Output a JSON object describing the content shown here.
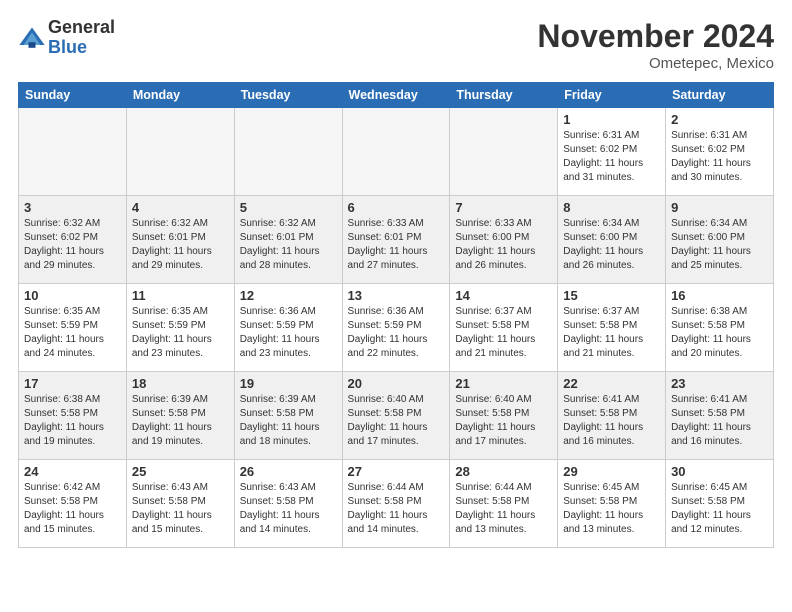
{
  "logo": {
    "general": "General",
    "blue": "Blue"
  },
  "title": "November 2024",
  "location": "Ometepec, Mexico",
  "weekdays": [
    "Sunday",
    "Monday",
    "Tuesday",
    "Wednesday",
    "Thursday",
    "Friday",
    "Saturday"
  ],
  "weeks": [
    [
      {
        "day": "",
        "info": ""
      },
      {
        "day": "",
        "info": ""
      },
      {
        "day": "",
        "info": ""
      },
      {
        "day": "",
        "info": ""
      },
      {
        "day": "",
        "info": ""
      },
      {
        "day": "1",
        "info": "Sunrise: 6:31 AM\nSunset: 6:02 PM\nDaylight: 11 hours\nand 31 minutes."
      },
      {
        "day": "2",
        "info": "Sunrise: 6:31 AM\nSunset: 6:02 PM\nDaylight: 11 hours\nand 30 minutes."
      }
    ],
    [
      {
        "day": "3",
        "info": "Sunrise: 6:32 AM\nSunset: 6:02 PM\nDaylight: 11 hours\nand 29 minutes."
      },
      {
        "day": "4",
        "info": "Sunrise: 6:32 AM\nSunset: 6:01 PM\nDaylight: 11 hours\nand 29 minutes."
      },
      {
        "day": "5",
        "info": "Sunrise: 6:32 AM\nSunset: 6:01 PM\nDaylight: 11 hours\nand 28 minutes."
      },
      {
        "day": "6",
        "info": "Sunrise: 6:33 AM\nSunset: 6:01 PM\nDaylight: 11 hours\nand 27 minutes."
      },
      {
        "day": "7",
        "info": "Sunrise: 6:33 AM\nSunset: 6:00 PM\nDaylight: 11 hours\nand 26 minutes."
      },
      {
        "day": "8",
        "info": "Sunrise: 6:34 AM\nSunset: 6:00 PM\nDaylight: 11 hours\nand 26 minutes."
      },
      {
        "day": "9",
        "info": "Sunrise: 6:34 AM\nSunset: 6:00 PM\nDaylight: 11 hours\nand 25 minutes."
      }
    ],
    [
      {
        "day": "10",
        "info": "Sunrise: 6:35 AM\nSunset: 5:59 PM\nDaylight: 11 hours\nand 24 minutes."
      },
      {
        "day": "11",
        "info": "Sunrise: 6:35 AM\nSunset: 5:59 PM\nDaylight: 11 hours\nand 23 minutes."
      },
      {
        "day": "12",
        "info": "Sunrise: 6:36 AM\nSunset: 5:59 PM\nDaylight: 11 hours\nand 23 minutes."
      },
      {
        "day": "13",
        "info": "Sunrise: 6:36 AM\nSunset: 5:59 PM\nDaylight: 11 hours\nand 22 minutes."
      },
      {
        "day": "14",
        "info": "Sunrise: 6:37 AM\nSunset: 5:58 PM\nDaylight: 11 hours\nand 21 minutes."
      },
      {
        "day": "15",
        "info": "Sunrise: 6:37 AM\nSunset: 5:58 PM\nDaylight: 11 hours\nand 21 minutes."
      },
      {
        "day": "16",
        "info": "Sunrise: 6:38 AM\nSunset: 5:58 PM\nDaylight: 11 hours\nand 20 minutes."
      }
    ],
    [
      {
        "day": "17",
        "info": "Sunrise: 6:38 AM\nSunset: 5:58 PM\nDaylight: 11 hours\nand 19 minutes."
      },
      {
        "day": "18",
        "info": "Sunrise: 6:39 AM\nSunset: 5:58 PM\nDaylight: 11 hours\nand 19 minutes."
      },
      {
        "day": "19",
        "info": "Sunrise: 6:39 AM\nSunset: 5:58 PM\nDaylight: 11 hours\nand 18 minutes."
      },
      {
        "day": "20",
        "info": "Sunrise: 6:40 AM\nSunset: 5:58 PM\nDaylight: 11 hours\nand 17 minutes."
      },
      {
        "day": "21",
        "info": "Sunrise: 6:40 AM\nSunset: 5:58 PM\nDaylight: 11 hours\nand 17 minutes."
      },
      {
        "day": "22",
        "info": "Sunrise: 6:41 AM\nSunset: 5:58 PM\nDaylight: 11 hours\nand 16 minutes."
      },
      {
        "day": "23",
        "info": "Sunrise: 6:41 AM\nSunset: 5:58 PM\nDaylight: 11 hours\nand 16 minutes."
      }
    ],
    [
      {
        "day": "24",
        "info": "Sunrise: 6:42 AM\nSunset: 5:58 PM\nDaylight: 11 hours\nand 15 minutes."
      },
      {
        "day": "25",
        "info": "Sunrise: 6:43 AM\nSunset: 5:58 PM\nDaylight: 11 hours\nand 15 minutes."
      },
      {
        "day": "26",
        "info": "Sunrise: 6:43 AM\nSunset: 5:58 PM\nDaylight: 11 hours\nand 14 minutes."
      },
      {
        "day": "27",
        "info": "Sunrise: 6:44 AM\nSunset: 5:58 PM\nDaylight: 11 hours\nand 14 minutes."
      },
      {
        "day": "28",
        "info": "Sunrise: 6:44 AM\nSunset: 5:58 PM\nDaylight: 11 hours\nand 13 minutes."
      },
      {
        "day": "29",
        "info": "Sunrise: 6:45 AM\nSunset: 5:58 PM\nDaylight: 11 hours\nand 13 minutes."
      },
      {
        "day": "30",
        "info": "Sunrise: 6:45 AM\nSunset: 5:58 PM\nDaylight: 11 hours\nand 12 minutes."
      }
    ]
  ]
}
